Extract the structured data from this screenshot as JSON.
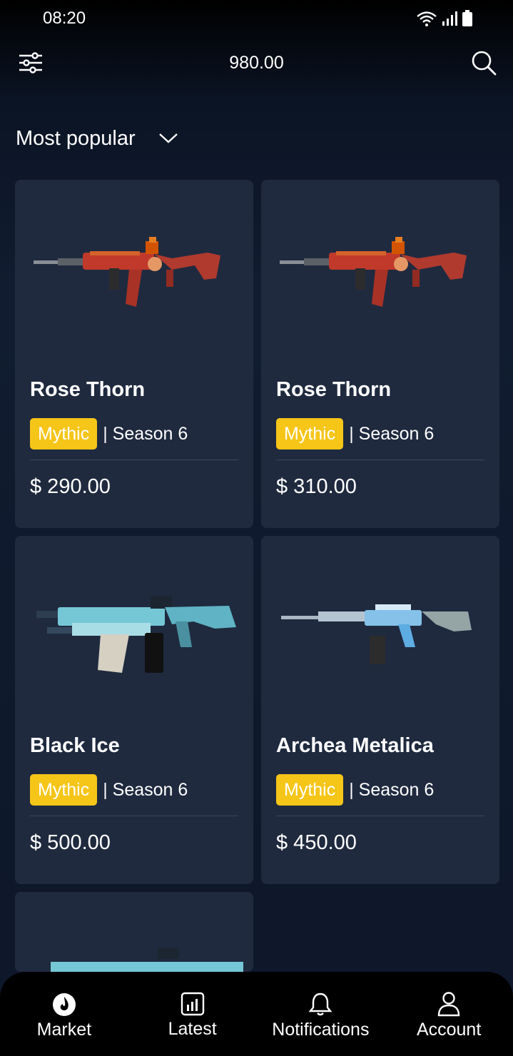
{
  "status_bar": {
    "time": "08:20"
  },
  "header": {
    "balance": "980.00"
  },
  "sort": {
    "label": "Most popular"
  },
  "colors": {
    "accent": "#f5c518",
    "card_bg": "#1f2a3f",
    "background": "#111c30"
  },
  "items": [
    {
      "name": "Rose Thorn",
      "rarity": "Mythic",
      "season": "| Season 6",
      "price": "$ 290.00",
      "skin": "rose"
    },
    {
      "name": "Rose Thorn",
      "rarity": "Mythic",
      "season": "| Season 6",
      "price": "$ 310.00",
      "skin": "rose"
    },
    {
      "name": "Black Ice",
      "rarity": "Mythic",
      "season": "| Season 6",
      "price": "$ 500.00",
      "skin": "ice"
    },
    {
      "name": "Archea Metalica",
      "rarity": "Mythic",
      "season": "| Season 6",
      "price": "$ 450.00",
      "skin": "metal"
    }
  ],
  "bottom_nav": [
    {
      "label": "Market",
      "icon": "fire-icon"
    },
    {
      "label": "Latest",
      "icon": "bar-chart-icon"
    },
    {
      "label": "Notifications",
      "icon": "bell-icon"
    },
    {
      "label": "Account",
      "icon": "user-icon"
    }
  ]
}
